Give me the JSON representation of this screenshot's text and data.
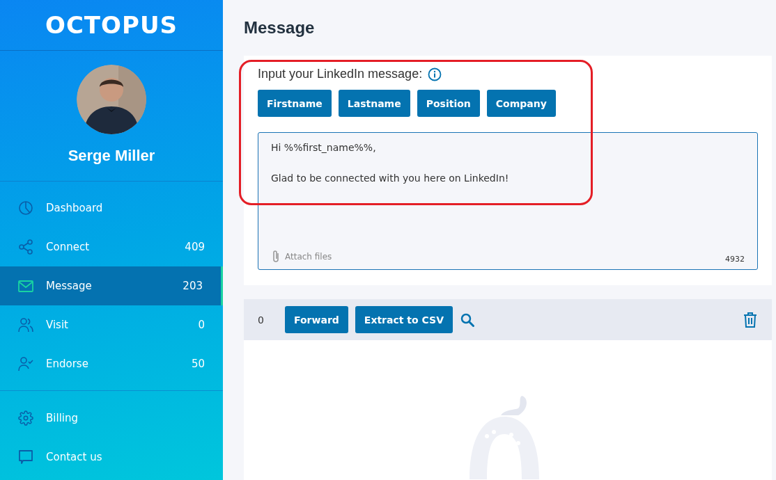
{
  "sidebar": {
    "logo": "OCTOPUS",
    "profile": {
      "name": "Serge Miller"
    },
    "items": [
      {
        "label": "Dashboard",
        "kind": "dashboard",
        "selected": false
      },
      {
        "label": "Connect",
        "kind": "connect",
        "count": "409",
        "selected": false
      },
      {
        "label": "Message",
        "kind": "message",
        "count": "203",
        "selected": true
      },
      {
        "label": "Visit",
        "kind": "visit",
        "count": "0",
        "selected": false
      },
      {
        "label": "Endorse",
        "kind": "endorse",
        "count": "50",
        "selected": false
      }
    ],
    "footer_items": [
      {
        "label": "Billing",
        "kind": "billing"
      },
      {
        "label": "Contact us",
        "kind": "contact"
      }
    ]
  },
  "page_title": "Message",
  "composer": {
    "label": "Input your LinkedIn message:",
    "tokens": [
      "Firstname",
      "Lastname",
      "Position",
      "Company"
    ],
    "message": "Hi %%first_name%%,\n\nGlad to be connected with you here on LinkedIn!",
    "attach": "Attach files",
    "char_count": "4932"
  },
  "toolbar": {
    "count": "0",
    "buttons": [
      "Forward",
      "Extract to CSV"
    ]
  }
}
